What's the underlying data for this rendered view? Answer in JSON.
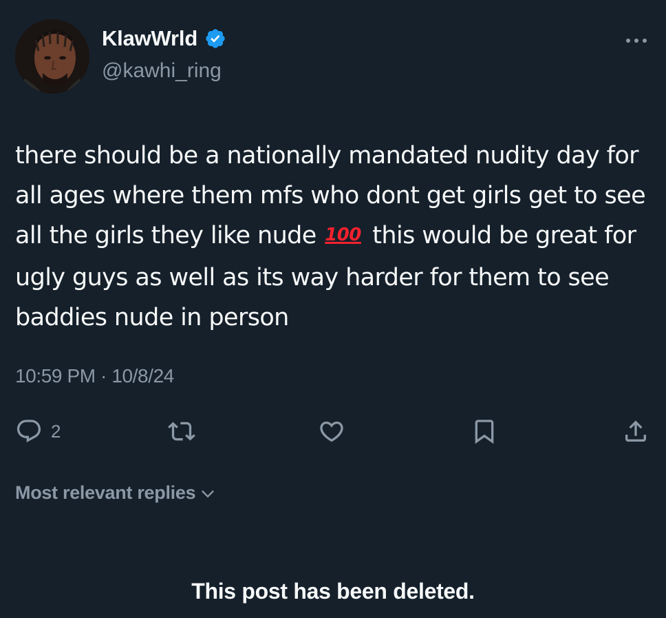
{
  "author": {
    "display_name": "KlawWrld",
    "handle": "@kawhi_ring",
    "verified_color": "#1d9bf0"
  },
  "post": {
    "text_parts": [
      "there should be a nationally mandated nudity day for all ages where them mfs who dont get girls get to see all the girls they like nude",
      "this would be great for ugly guys as well as its way harder for them to see baddies nude in person"
    ],
    "emoji": "100",
    "timestamp": "10:59 PM · 10/8/24"
  },
  "actions": {
    "reply_count": "2",
    "icons": [
      "reply-icon",
      "repost-icon",
      "like-icon",
      "bookmark-icon",
      "share-icon"
    ]
  },
  "replies": {
    "sort_label": "Most relevant replies",
    "deleted_notice": "This post has been deleted."
  },
  "colors": {
    "background": "#15202b",
    "text_primary": "#f7f9f9",
    "text_secondary": "#8b98a5",
    "emoji_red": "#f4212e"
  }
}
